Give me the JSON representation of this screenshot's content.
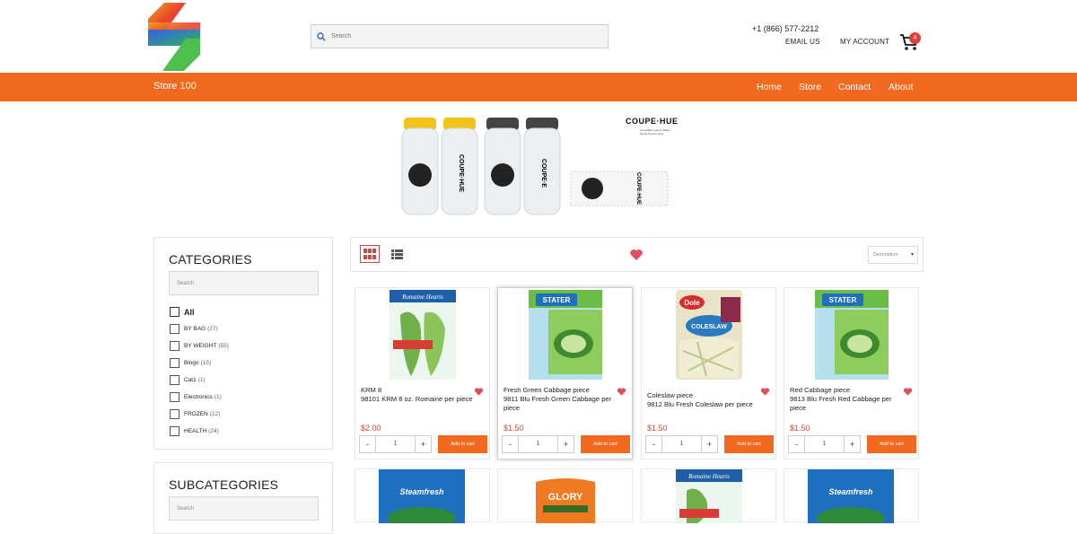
{
  "header": {
    "search_placeholder": "Search",
    "phone": "+1 (866) 577-2212",
    "email_label": "EMAIL US",
    "account_label": "MY ACCOUNT",
    "cart_count": "4"
  },
  "nav": {
    "store_name": "Store 100",
    "links": [
      "Home",
      "Store",
      "Contact",
      "About"
    ]
  },
  "banner": {
    "brand": "COUPE·HUE",
    "caption": "CamelBak Custom Bottle Model Podium 21oz"
  },
  "colors": {
    "accent": "#f26a1f",
    "price": "#d24b3b",
    "heart": "#e0505a"
  },
  "categories": {
    "title": "CATEGORIES",
    "search_placeholder": "Search",
    "items": [
      {
        "label": "All",
        "count": ""
      },
      {
        "label": "BY BAG",
        "count": "(27)"
      },
      {
        "label": "BY WEIGHT",
        "count": "(55)"
      },
      {
        "label": "Bingo",
        "count": "(15)"
      },
      {
        "label": "Cat1",
        "count": "(1)"
      },
      {
        "label": "Electronics",
        "count": "(1)"
      },
      {
        "label": "FROZEN",
        "count": "(12)"
      },
      {
        "label": "HEALTH",
        "count": "(24)"
      }
    ]
  },
  "subcategories": {
    "title": "SUBCATEGORIES",
    "search_placeholder": "Search"
  },
  "toolbar": {
    "sort_label": "Description"
  },
  "products": [
    {
      "name": "KRM 8\n98101 KRM 8 oz. Romaine per piece",
      "price": "$2.00",
      "qty": "1",
      "add_label": "Add to cart",
      "image": "romaine-hearts-bag"
    },
    {
      "name": "Fresh Green Cabbage piece\n9811 Blu Fresh Green Cabbage per piece",
      "price": "$1.50",
      "qty": "1",
      "add_label": "Add to cart",
      "image": "stater-bros-shredded-cabbage"
    },
    {
      "name": "Coleslaw piece\n9812 Blu Fresh Coleslaw per piece",
      "price": "$1.50",
      "qty": "1",
      "add_label": "Add to cart",
      "image": "dole-classic-coleslaw"
    },
    {
      "name": "Red Cabbage piece\n9813 Blu Fresh Red Cabbage per piece",
      "price": "$1.50",
      "qty": "1",
      "add_label": "Add to cart",
      "image": "stater-bros-red-cabbage"
    }
  ],
  "products_row2": [
    {
      "image": "steamfresh-bag"
    },
    {
      "image": "glory-bag"
    },
    {
      "image": "romaine-hearts-bag"
    },
    {
      "image": "steamfresh-bag"
    }
  ]
}
